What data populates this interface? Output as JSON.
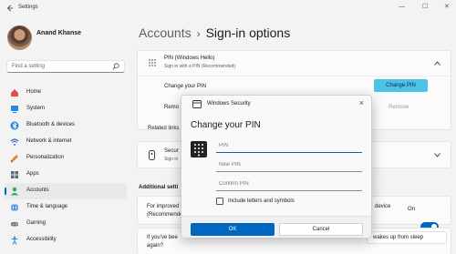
{
  "window": {
    "title": "Settings"
  },
  "user": {
    "name": "Anand Khanse"
  },
  "search": {
    "placeholder": "Find a setting"
  },
  "nav": [
    {
      "label": "Home",
      "icon": "home-icon",
      "color": "#d9534f"
    },
    {
      "label": "System",
      "icon": "monitor-icon",
      "color": "#2b88d8"
    },
    {
      "label": "Bluetooth & devices",
      "icon": "bluetooth-icon",
      "color": "#2b88d8"
    },
    {
      "label": "Network & internet",
      "icon": "wifi-icon",
      "color": "#3d6db5"
    },
    {
      "label": "Personalization",
      "icon": "brush-icon",
      "color": "#e08a2c"
    },
    {
      "label": "Apps",
      "icon": "apps-icon",
      "color": "#5b6b7b"
    },
    {
      "label": "Accounts",
      "icon": "person-icon",
      "color": "#2faa6e"
    },
    {
      "label": "Time & language",
      "icon": "globe-icon",
      "color": "#2b88d8"
    },
    {
      "label": "Gaming",
      "icon": "gamepad-icon",
      "color": "#7a7a7a"
    },
    {
      "label": "Accessibility",
      "icon": "accessibility-icon",
      "color": "#2b88d8"
    }
  ],
  "breadcrumb": {
    "parent": "Accounts",
    "separator": "›",
    "current": "Sign-in options"
  },
  "pin": {
    "title": "PIN (Windows Hello)",
    "subtitle": "Sign in with a PIN (Recommended)",
    "change_label": "Change your PIN",
    "change_button": "Change PIN",
    "remove_label": "Remo",
    "remove_button": "Remove"
  },
  "related_links": "Related links",
  "security_key": {
    "title": "Secur",
    "subtitle": "Sign in"
  },
  "additional": {
    "heading": "Additional setti",
    "improve_label": "For improved",
    "recommend_label": "(Recommende",
    "device_text": "device",
    "toggle_label": "On",
    "away_label": "If you've bee",
    "again_label": "again?",
    "wake_text": "wakes up from sleep"
  },
  "dialog": {
    "title": "Windows Security",
    "heading": "Change your PIN",
    "pin_placeholder": "PIN",
    "new_pin_placeholder": "New PIN",
    "confirm_pin_placeholder": "Confirm PIN",
    "checkbox_label": "Include letters and symbols",
    "ok_button": "OK",
    "cancel_button": "Cancel",
    "close_glyph": "×"
  },
  "colors": {
    "accent": "#0067c0",
    "change_pin_button": "#4cc2e8"
  }
}
